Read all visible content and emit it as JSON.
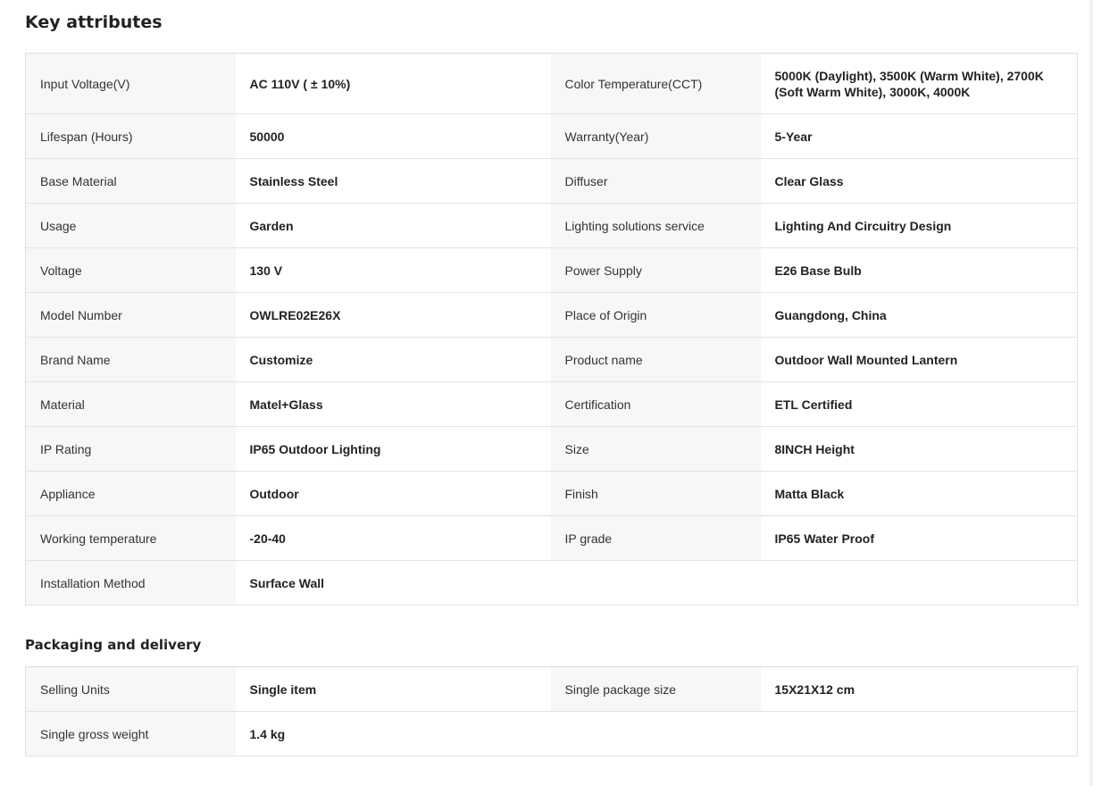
{
  "key_attributes": {
    "title": "Key attributes",
    "rows": [
      [
        {
          "label": "Input Voltage(V)",
          "value": "AC 110V ( ± 10%)"
        },
        {
          "label": "Color Temperature(CCT)",
          "value": "5000K (Daylight), 3500K (Warm White), 2700K (Soft Warm White), 3000K, 4000K"
        }
      ],
      [
        {
          "label": "Lifespan (Hours)",
          "value": "50000"
        },
        {
          "label": "Warranty(Year)",
          "value": "5-Year"
        }
      ],
      [
        {
          "label": "Base Material",
          "value": "Stainless Steel"
        },
        {
          "label": "Diffuser",
          "value": "Clear Glass"
        }
      ],
      [
        {
          "label": "Usage",
          "value": "Garden"
        },
        {
          "label": "Lighting solutions service",
          "value": "Lighting And Circuitry Design"
        }
      ],
      [
        {
          "label": "Voltage",
          "value": "130 V"
        },
        {
          "label": "Power Supply",
          "value": "E26 Base Bulb"
        }
      ],
      [
        {
          "label": "Model Number",
          "value": "OWLRE02E26X"
        },
        {
          "label": "Place of Origin",
          "value": "Guangdong, China"
        }
      ],
      [
        {
          "label": "Brand Name",
          "value": "Customize"
        },
        {
          "label": "Product name",
          "value": "Outdoor Wall Mounted Lantern"
        }
      ],
      [
        {
          "label": "Material",
          "value": "Matel+Glass"
        },
        {
          "label": "Certification",
          "value": "ETL Certified"
        }
      ],
      [
        {
          "label": "IP Rating",
          "value": "IP65 Outdoor Lighting"
        },
        {
          "label": "Size",
          "value": "8INCH Height"
        }
      ],
      [
        {
          "label": "Appliance",
          "value": "Outdoor"
        },
        {
          "label": "Finish",
          "value": "Matta Black"
        }
      ],
      [
        {
          "label": "Working temperature",
          "value": "-20-40"
        },
        {
          "label": "IP grade",
          "value": "IP65 Water Proof"
        }
      ],
      [
        {
          "label": "Installation Method",
          "value": "Surface Wall"
        }
      ]
    ]
  },
  "packaging": {
    "title": "Packaging and delivery",
    "rows": [
      [
        {
          "label": "Selling Units",
          "value": "Single item"
        },
        {
          "label": "Single package size",
          "value": "15X21X12 cm"
        }
      ],
      [
        {
          "label": "Single gross weight",
          "value": "1.4 kg"
        }
      ]
    ]
  }
}
